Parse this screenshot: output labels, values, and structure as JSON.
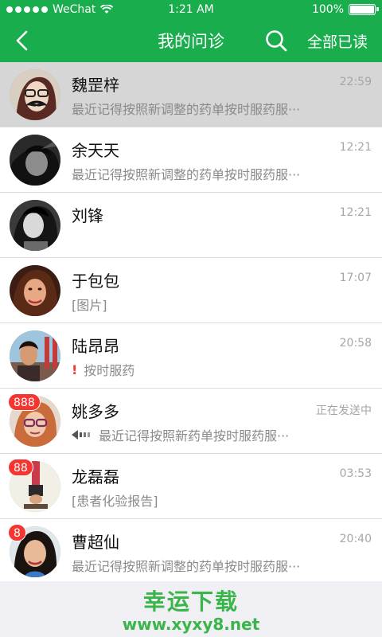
{
  "status_bar": {
    "carrier": "WeChat",
    "time": "1:21 AM",
    "battery": "100%",
    "battery_level": 1.0
  },
  "nav": {
    "title": "我的问诊",
    "read_all": "全部已读",
    "back_icon": "back-chevron-icon",
    "search_icon": "search-icon",
    "color": "#1aad4d"
  },
  "conversations": [
    {
      "name": "魏罡梓",
      "time": "22:59",
      "preview": "最近记得按照新调整的药单按时服药服···",
      "badge": "",
      "selected": true
    },
    {
      "name": "余天天",
      "time": "12:21",
      "preview": "最近记得按照新调整的药单按时服药服···",
      "badge": "",
      "selected": false
    },
    {
      "name": "刘锋",
      "time": "12:21",
      "preview": "",
      "badge": "",
      "selected": false
    },
    {
      "name": "于包包",
      "time": "17:07",
      "preview": "[图片]",
      "badge": "",
      "selected": false
    },
    {
      "name": "陆昂昂",
      "time": "20:58",
      "preview_mark": "!",
      "preview": "按时服药",
      "badge": "",
      "selected": false
    },
    {
      "name": "姚多多",
      "time": "正在发送中",
      "preview": "最近记得按照新药单按时服药服···",
      "badge": "888",
      "selected": false
    },
    {
      "name": "龙磊磊",
      "time": "03:53",
      "preview": "[患者化验报告]",
      "badge": "88",
      "selected": false
    },
    {
      "name": "曹超仙",
      "time": "20:40",
      "preview": "最近记得按照新调整的药单按时服药服···",
      "badge": "8",
      "selected": false
    }
  ],
  "watermark": {
    "title": "幸运下载",
    "url": "www.xyxy8.net"
  }
}
